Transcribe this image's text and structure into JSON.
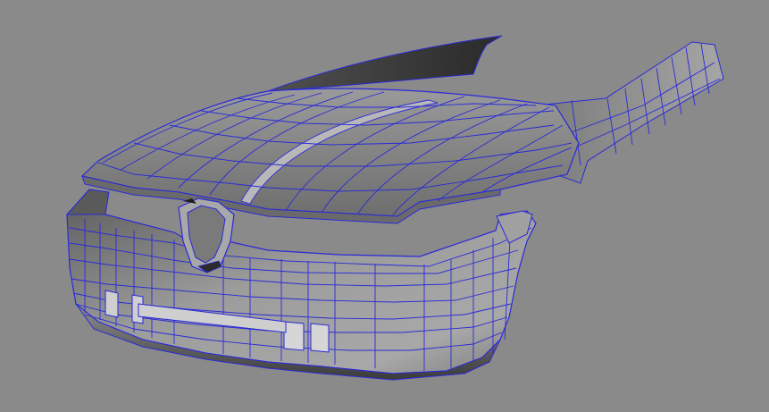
{
  "viewport": {
    "background": "#8a8a8a",
    "wireframe_color": "#2a2ad8",
    "shade_light": "#b4b4b4",
    "shade_mid": "#8c8c8c",
    "shade_dark": "#3c3c3c"
  },
  "model": {
    "parts": [
      "hood-panel",
      "bumper-panel",
      "grille-badge",
      "side-fender-strip",
      "windshield-edge"
    ]
  }
}
